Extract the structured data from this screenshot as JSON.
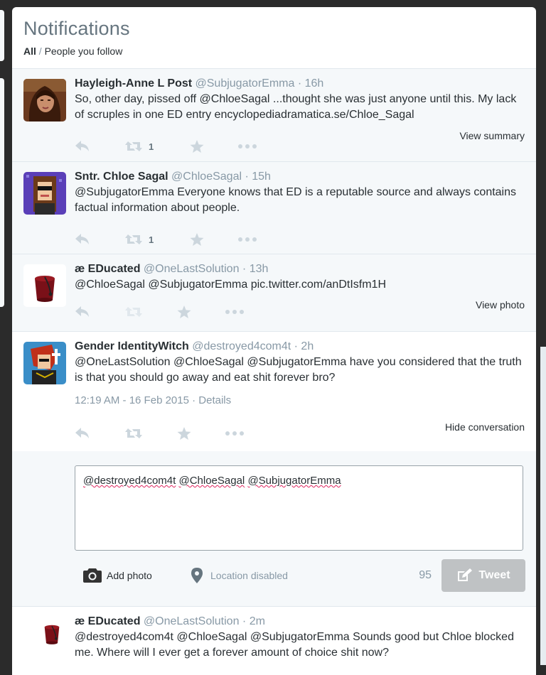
{
  "header": {
    "title": "Notifications",
    "filter_all": "All",
    "filter_sep": "/",
    "filter_following": "People you follow"
  },
  "tweets": [
    {
      "fullname": "Hayleigh-Anne L Post",
      "username": "@SubjugatorEmma",
      "time": "· 16h",
      "text": "So, other day, pissed off @ChloeSagal ...thought she was just anyone until this. My lack of scruples in one ED entry encyclopediadramatica.se/Chloe_Sagal",
      "retweet_count": "1",
      "link": "View summary"
    },
    {
      "fullname": "Sntr. Chloe Sagal",
      "username": "@ChloeSagal",
      "time": "· 15h",
      "text": "@SubjugatorEmma Everyone knows that ED is a reputable source and always contains factual information about people.",
      "retweet_count": "1"
    },
    {
      "fullname": "æ EDucated",
      "username": "@OneLastSolution",
      "time": "· 13h",
      "text": "@ChloeSagal @SubjugatorEmma pic.twitter.com/anDtIsfm1H",
      "link": "View photo"
    },
    {
      "fullname": "Gender IdentityWitch",
      "username": "@destroyed4com4t",
      "time": "· 2h",
      "text": "@OneLastSolution @ChloeSagal @SubjugatorEmma have you considered that the truth is that you should go away and eat shit forever bro?",
      "timestamp": "12:19 AM - 16 Feb 2015",
      "details": "· Details",
      "link": "Hide conversation"
    },
    {
      "fullname": "æ EDucated",
      "username": "@OneLastSolution",
      "time": "· 2m",
      "text": "@destroyed4com4t @ChloeSagal @SubjugatorEmma Sounds good but Chloe blocked me. Where will I ever get a forever amount of choice shit now?"
    }
  ],
  "reply": {
    "mentions": [
      "@destroyed4com4t",
      "@ChloeSagal",
      "@SubjugatorEmma"
    ],
    "add_photo": "Add photo",
    "location": "Location disabled",
    "char_count": "95",
    "tweet_button": "Tweet"
  },
  "icons": [
    "reply-icon",
    "retweet-icon",
    "favorite-icon",
    "more-icon",
    "camera-icon",
    "location-pin-icon",
    "compose-icon"
  ]
}
